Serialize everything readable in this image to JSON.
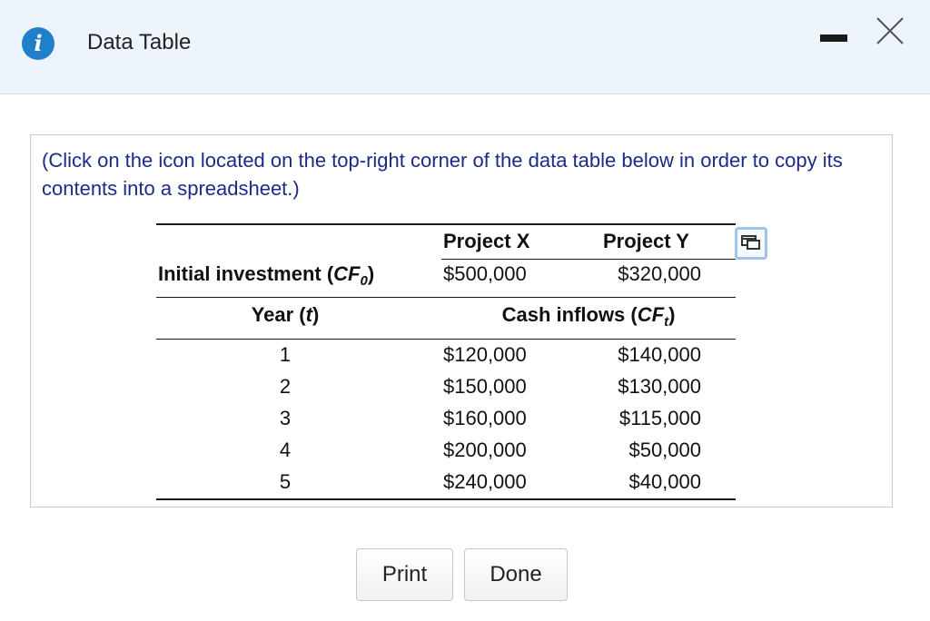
{
  "dialog": {
    "title": "Data Table",
    "info_icon": "info-icon",
    "minimize_icon": "minimize-icon",
    "close_icon": "close-icon"
  },
  "instructions": "(Click on the icon located on the top-right corner of the data table below in order to copy its contents into a spreadsheet.)",
  "table": {
    "copy_icon": "copy-to-spreadsheet-icon",
    "header": {
      "project_x": "Project X",
      "project_y": "Project Y"
    },
    "initial_investment": {
      "label_prefix": "Initial investment (",
      "label_cf": "CF",
      "label_sub": "0",
      "label_suffix": ")",
      "project_x": "$500,000",
      "project_y": "$320,000"
    },
    "year_label": {
      "prefix": "Year (",
      "var": "t",
      "suffix": ")"
    },
    "cash_inflows_label": {
      "prefix": "Cash inflows (",
      "cf": "CF",
      "sub": "t",
      "suffix": ")"
    },
    "rows": [
      {
        "year": "1",
        "project_x": "$120,000",
        "project_y": "$140,000"
      },
      {
        "year": "2",
        "project_x": "$150,000",
        "project_y": "$130,000"
      },
      {
        "year": "3",
        "project_x": "$160,000",
        "project_y": "$115,000"
      },
      {
        "year": "4",
        "project_x": "$200,000",
        "project_y": "$50,000"
      },
      {
        "year": "5",
        "project_x": "$240,000",
        "project_y": "$40,000"
      }
    ]
  },
  "buttons": {
    "print": "Print",
    "done": "Done"
  },
  "colors": {
    "accent": "#1f80c9",
    "instructions_text": "#1c2b8a",
    "titlebar_bg": "#eef4fb"
  }
}
